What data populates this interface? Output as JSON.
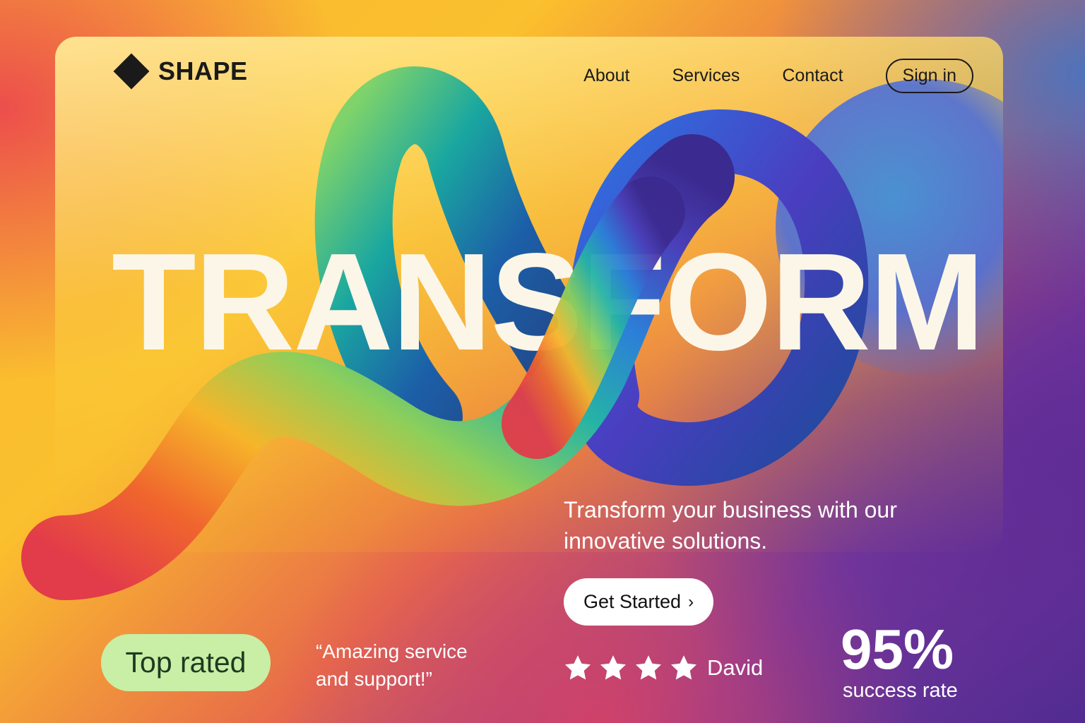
{
  "brand": {
    "name": "SHAPE",
    "logo_icon": "diamond-icon"
  },
  "nav": {
    "links": [
      "About",
      "Services",
      "Contact"
    ],
    "signin_label": "Sign in"
  },
  "hero": {
    "title": "TRANSFORM",
    "tagline": "Transform your business with our innovative solutions.",
    "cta_label": "Get Started",
    "cta_icon": "chevron-right-icon"
  },
  "social_proof": {
    "badge": "Top rated",
    "quote": "“Amazing service and support!”",
    "stars": 4,
    "reviewer": "David"
  },
  "stats": {
    "value": "95%",
    "label": "success rate"
  },
  "colors": {
    "badge_bg": "#c9eea5",
    "title_text": "#fbf6e8",
    "ink": "#1a1a1a"
  }
}
